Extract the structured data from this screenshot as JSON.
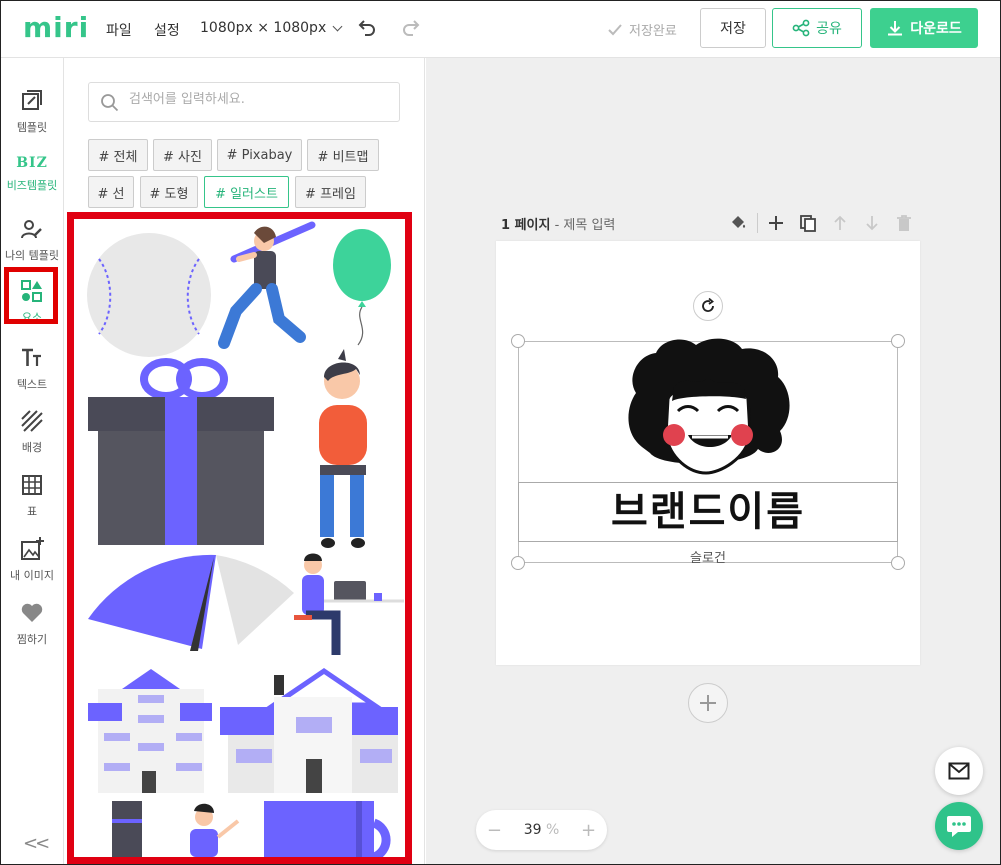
{
  "app": {
    "logo": "miri"
  },
  "topbar": {
    "menu_file": "파일",
    "menu_settings": "설정",
    "canvas_size": "1080px × 1080px",
    "save_status": "저장완료",
    "save_label": "저장",
    "share_label": "공유",
    "download_label": "다운로드"
  },
  "rail": {
    "items": [
      {
        "label": "템플릿"
      },
      {
        "label": "비즈템플릿",
        "badge": "BIZ"
      },
      {
        "label": "나의 템플릿"
      },
      {
        "label": "요소"
      },
      {
        "label": "텍스트"
      },
      {
        "label": "배경"
      },
      {
        "label": "표"
      },
      {
        "label": "내 이미지"
      },
      {
        "label": "찜하기"
      }
    ],
    "collapse": "<<"
  },
  "panel": {
    "search_placeholder": "검색어를 입력하세요.",
    "tags": [
      {
        "label": "# 전체"
      },
      {
        "label": "# 사진"
      },
      {
        "label": "# Pixabay"
      },
      {
        "label": "# 비트맵"
      },
      {
        "label": "# 선"
      },
      {
        "label": "# 도형"
      },
      {
        "label": "# 일러스트",
        "active": true
      },
      {
        "label": "# 프레임"
      }
    ]
  },
  "canvas": {
    "page_number": "1 페이지",
    "page_title": "- 제목 입력",
    "brand_text": "브랜드이름",
    "slogan": "슬로건",
    "zoom_value": "39",
    "zoom_unit": "%"
  },
  "colors": {
    "brand_green": "#35c58a",
    "highlight_red": "#e00012",
    "illustration_purple": "#6c63ff",
    "illustration_dark": "#4a4a57"
  }
}
